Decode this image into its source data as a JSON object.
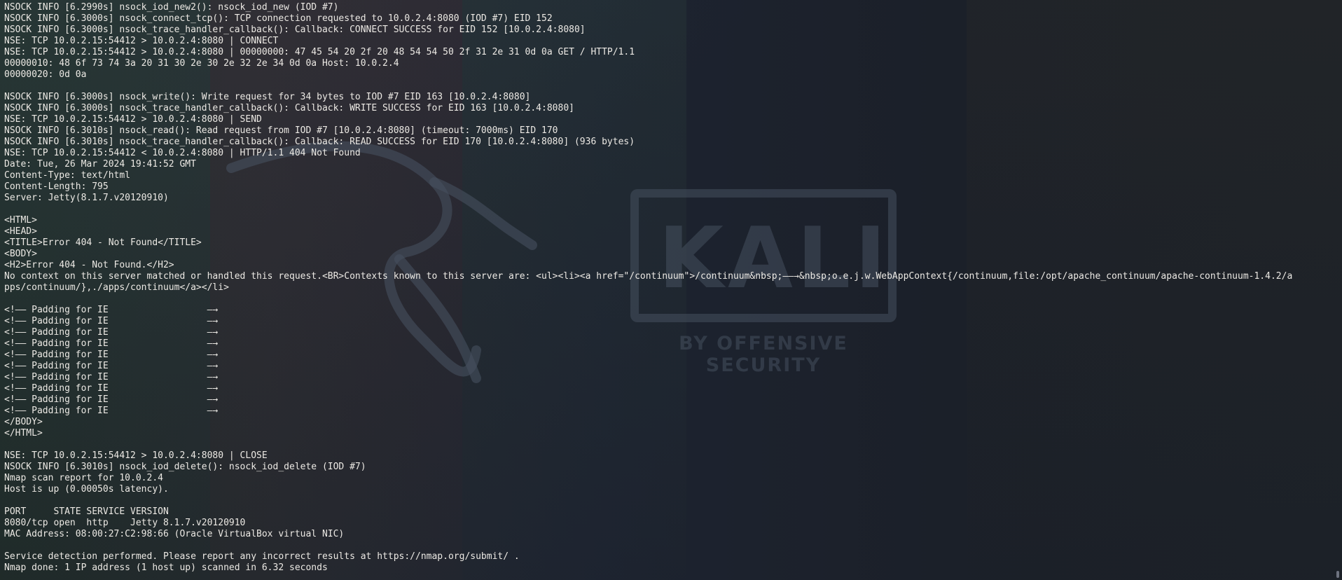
{
  "terminal": {
    "lines": [
      "NSOCK INFO [6.2990s] nsock_iod_new2(): nsock_iod_new (IOD #7)",
      "NSOCK INFO [6.3000s] nsock_connect_tcp(): TCP connection requested to 10.0.2.4:8080 (IOD #7) EID 152",
      "NSOCK INFO [6.3000s] nsock_trace_handler_callback(): Callback: CONNECT SUCCESS for EID 152 [10.0.2.4:8080]",
      "NSE: TCP 10.0.2.15:54412 > 10.0.2.4:8080 | CONNECT",
      "NSE: TCP 10.0.2.15:54412 > 10.0.2.4:8080 | 00000000: 47 45 54 20 2f 20 48 54 54 50 2f 31 2e 31 0d 0a GET / HTTP/1.1",
      "00000010: 48 6f 73 74 3a 20 31 30 2e 30 2e 32 2e 34 0d 0a Host: 10.0.2.4",
      "00000020: 0d 0a",
      "",
      "NSOCK INFO [6.3000s] nsock_write(): Write request for 34 bytes to IOD #7 EID 163 [10.0.2.4:8080]",
      "NSOCK INFO [6.3000s] nsock_trace_handler_callback(): Callback: WRITE SUCCESS for EID 163 [10.0.2.4:8080]",
      "NSE: TCP 10.0.2.15:54412 > 10.0.2.4:8080 | SEND",
      "NSOCK INFO [6.3010s] nsock_read(): Read request from IOD #7 [10.0.2.4:8080] (timeout: 7000ms) EID 170",
      "NSOCK INFO [6.3010s] nsock_trace_handler_callback(): Callback: READ SUCCESS for EID 170 [10.0.2.4:8080] (936 bytes)",
      "NSE: TCP 10.0.2.15:54412 < 10.0.2.4:8080 | HTTP/1.1 404 Not Found",
      "Date: Tue, 26 Mar 2024 19:41:52 GMT",
      "Content-Type: text/html",
      "Content-Length: 795",
      "Server: Jetty(8.1.7.v20120910)",
      "",
      "<HTML>",
      "<HEAD>",
      "<TITLE>Error 404 - Not Found</TITLE>",
      "<BODY>",
      "<H2>Error 404 - Not Found.</H2>",
      "No context on this server matched or handled this request.<BR>Contexts known to this server are: <ul><li><a href=\"/continuum\">/continuum&nbsp;——→&nbsp;o.e.j.w.WebAppContext{/continuum,file:/opt/apache_continuum/apache-continuum-1.4.2/a",
      "pps/continuum/},./apps/continuum</a></li>",
      "",
      "<!—— Padding for IE                  —→",
      "<!—— Padding for IE                  —→",
      "<!—— Padding for IE                  —→",
      "<!—— Padding for IE                  —→",
      "<!—— Padding for IE                  —→",
      "<!—— Padding for IE                  —→",
      "<!—— Padding for IE                  —→",
      "<!—— Padding for IE                  —→",
      "<!—— Padding for IE                  —→",
      "<!—— Padding for IE                  —→",
      "</BODY>",
      "</HTML>",
      "",
      "NSE: TCP 10.0.2.15:54412 > 10.0.2.4:8080 | CLOSE",
      "NSOCK INFO [6.3010s] nsock_iod_delete(): nsock_iod_delete (IOD #7)",
      "Nmap scan report for 10.0.2.4",
      "Host is up (0.00050s latency).",
      "",
      "PORT     STATE SERVICE VERSION",
      "8080/tcp open  http    Jetty 8.1.7.v20120910",
      "MAC Address: 08:00:27:C2:98:66 (Oracle VirtualBox virtual NIC)",
      "",
      "Service detection performed. Please report any incorrect results at https://nmap.org/submit/ .",
      "Nmap done: 1 IP address (1 host up) scanned in 6.32 seconds"
    ]
  },
  "wallpaper": {
    "logo_text": "KALI",
    "logo_subtitle": "BY OFFENSIVE SECURITY",
    "colors": {
      "background": "#1a1f2a",
      "terminal_text": "#ece9e4",
      "logo": "#46505f"
    }
  }
}
